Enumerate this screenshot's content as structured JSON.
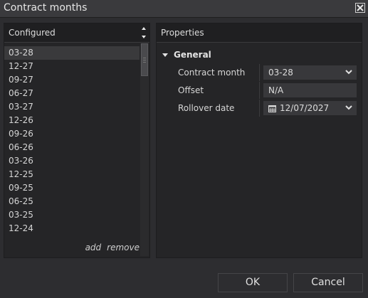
{
  "window": {
    "title": "Contract months"
  },
  "configured": {
    "header": "Configured",
    "items": [
      "03-28",
      "12-27",
      "09-27",
      "06-27",
      "03-27",
      "12-26",
      "09-26",
      "06-26",
      "03-26",
      "12-25",
      "09-25",
      "06-25",
      "03-25",
      "12-24"
    ],
    "selected_index": 0,
    "add_label": "add",
    "remove_label": "remove"
  },
  "properties": {
    "header": "Properties",
    "group": "General",
    "rows": [
      {
        "label": "Contract month",
        "value": "03-28",
        "control": "dropdown"
      },
      {
        "label": "Offset",
        "value": "N/A",
        "control": "text"
      },
      {
        "label": "Rollover date",
        "value": "12/07/2027",
        "control": "date-dropdown"
      }
    ]
  },
  "buttons": {
    "ok": "OK",
    "cancel": "Cancel"
  },
  "icons": {
    "close": "close-icon",
    "sort_up": "arrow-up-icon",
    "sort_down": "arrow-down-icon",
    "group_toggle": "triangle-down-icon",
    "dropdown": "chevron-down-icon",
    "calendar": "calendar-icon"
  },
  "colors": {
    "background": "#2d2d30",
    "panel": "#252527",
    "header": "#1f1f21",
    "field": "#38383b"
  }
}
